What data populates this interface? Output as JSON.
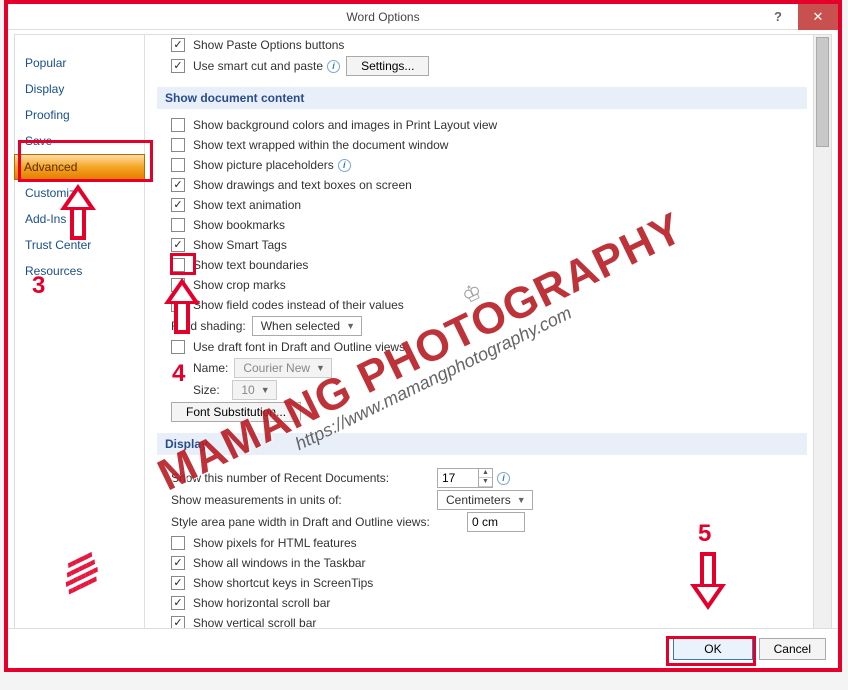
{
  "title": "Word Options",
  "nav": [
    "Popular",
    "Display",
    "Proofing",
    "Save",
    "Advanced",
    "Customize",
    "Add-Ins",
    "Trust Center",
    "Resources"
  ],
  "top": {
    "paste_opts": "Show Paste Options buttons",
    "smart_cut": "Use smart cut and paste",
    "settings": "Settings..."
  },
  "doc_header": "Show document content",
  "doc": {
    "bg": "Show background colors and images in Print Layout view",
    "wrap": "Show text wrapped within the document window",
    "pic": "Show picture placeholders",
    "draw": "Show drawings and text boxes on screen",
    "anim": "Show text animation",
    "book": "Show bookmarks",
    "smart": "Show Smart Tags",
    "bound": "Show text boundaries",
    "crop": "Show crop marks",
    "fieldc": "Show field codes instead of their values",
    "shade_lbl": "Field shading:",
    "shade_val": "When selected",
    "draft": "Use draft font in Draft and Outline views",
    "name_lbl": "Name:",
    "name_val": "Courier New",
    "size_lbl": "Size:",
    "size_val": "10",
    "fontsub": "Font Substitution..."
  },
  "disp_header": "Display",
  "disp": {
    "recent_lbl": "Show this number of Recent Documents:",
    "recent_val": "17",
    "units_lbl": "Show measurements in units of:",
    "units_val": "Centimeters",
    "stylepane_lbl": "Style area pane width in Draft and Outline views:",
    "stylepane_val": "0 cm",
    "pixels": "Show pixels for HTML features",
    "taskbar": "Show all windows in the Taskbar",
    "shortcut": "Show shortcut keys in ScreenTips",
    "hscroll": "Show horizontal scroll bar",
    "vscroll": "Show vertical scroll bar"
  },
  "buttons": {
    "ok": "OK",
    "cancel": "Cancel"
  },
  "anno": {
    "n3": "3",
    "n4": "4",
    "n5": "5"
  },
  "wm": {
    "main": "MAMANG PHOTOGRAPHY",
    "sub": "https://www.mamangphotography.com"
  }
}
